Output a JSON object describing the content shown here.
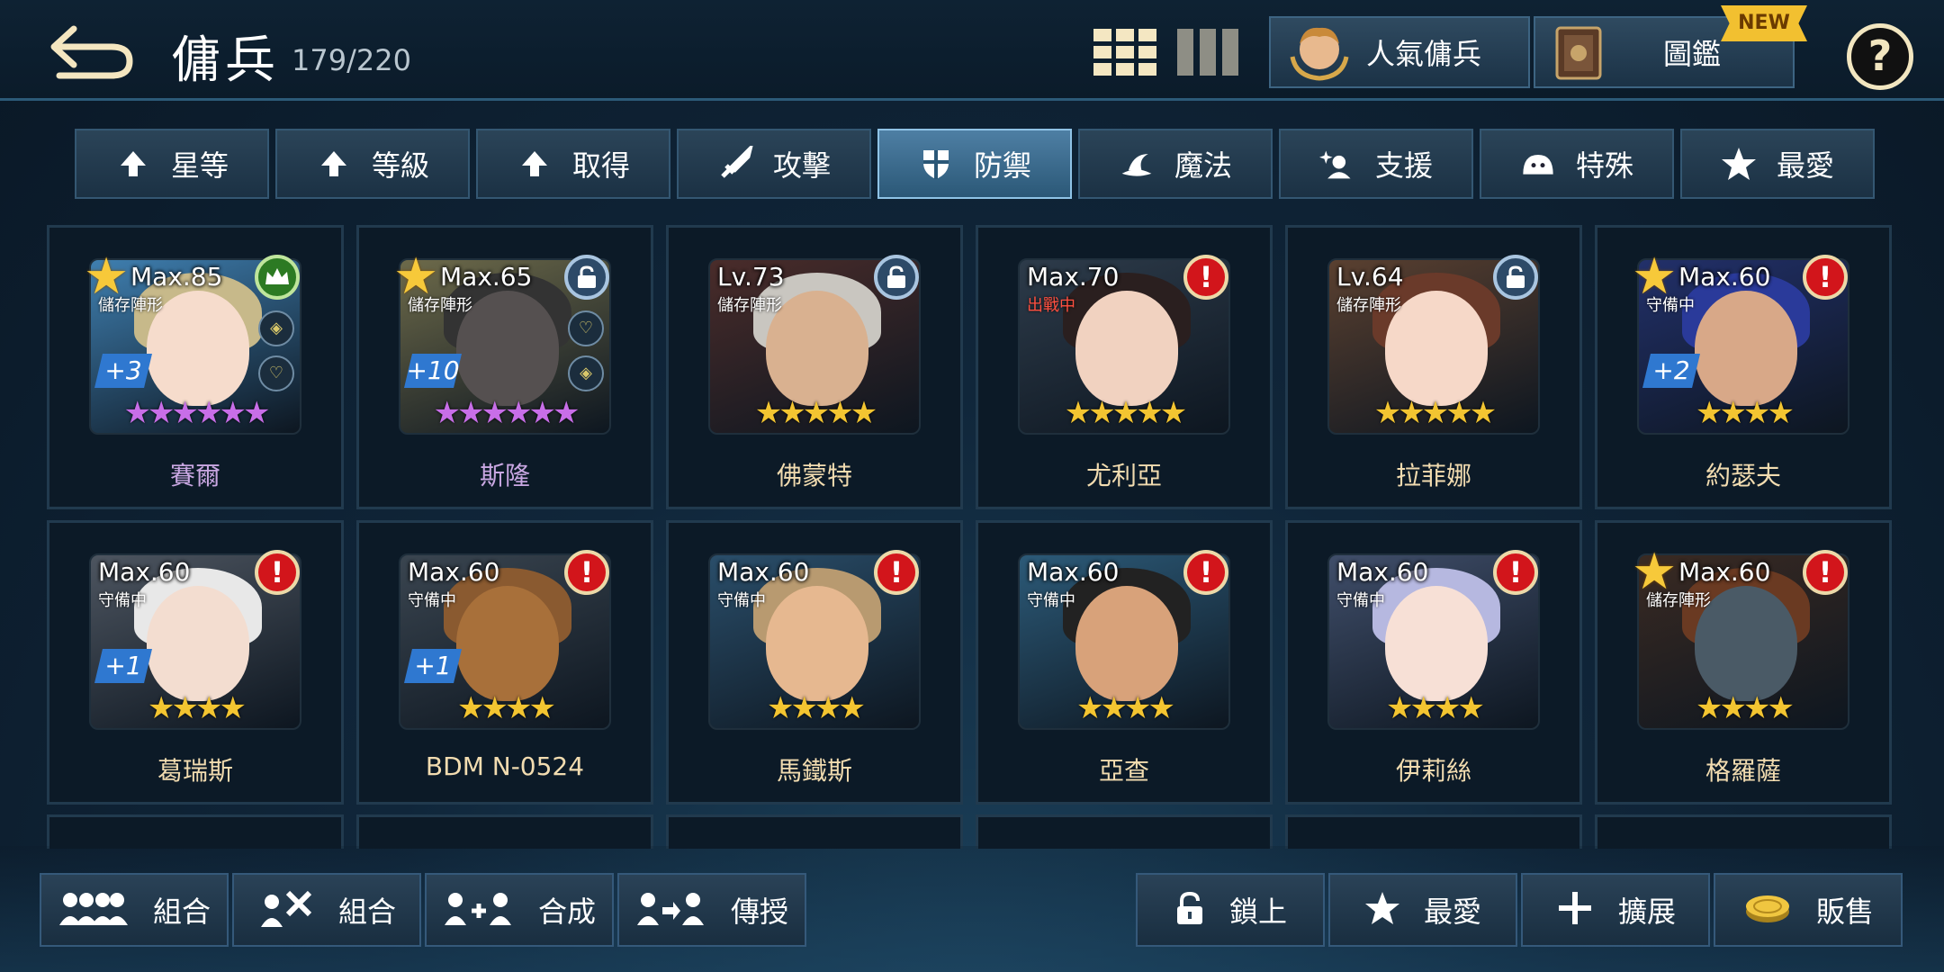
{
  "header": {
    "title": "傭兵",
    "count": "179/220",
    "popular_label": "人氣傭兵",
    "codex_label": "圖鑑",
    "new_badge": "NEW",
    "help_label": "?"
  },
  "filters": [
    {
      "label": "星等",
      "icon": "arrow-up-icon",
      "active": false
    },
    {
      "label": "等級",
      "icon": "arrow-up-icon",
      "active": false
    },
    {
      "label": "取得",
      "icon": "arrow-up-icon",
      "active": false
    },
    {
      "label": "攻擊",
      "icon": "sword-icon",
      "active": false
    },
    {
      "label": "防禦",
      "icon": "shield-icon",
      "active": true
    },
    {
      "label": "魔法",
      "icon": "wizard-hat-icon",
      "active": false
    },
    {
      "label": "支援",
      "icon": "support-sparkle-icon",
      "active": false
    },
    {
      "label": "特殊",
      "icon": "slime-icon",
      "active": false
    },
    {
      "label": "最愛",
      "icon": "star-icon",
      "active": false
    }
  ],
  "mercenaries": [
    {
      "name": "賽爾",
      "level": "Max.85",
      "status": "儲存陣形",
      "plus": "+3",
      "stars": 6,
      "star_color": "#c86ee8",
      "badge": "crown",
      "favorite": true,
      "name_color": "purple",
      "bg": "#3f7fb0",
      "hair": "#c7b98a",
      "skin": "#f6dccc"
    },
    {
      "name": "斯隆",
      "level": "Max.65",
      "status": "儲存陣形",
      "plus": "+10",
      "stars": 6,
      "star_color": "#c86ee8",
      "badge": "lock",
      "favorite": true,
      "name_color": "purple",
      "bg": "#6d6a4a",
      "hair": "#333333",
      "skin": "#555050"
    },
    {
      "name": "佛蒙特",
      "level": "Lv.73",
      "status": "儲存陣形",
      "plus": "",
      "stars": 5,
      "star_color": "#f3c531",
      "badge": "lock",
      "favorite": false,
      "name_color": "gold",
      "bg": "#4a2c2a",
      "hair": "#c9c6c0",
      "skin": "#d9b190"
    },
    {
      "name": "尤利亞",
      "level": "Max.70",
      "status": "出戰中",
      "plus": "",
      "stars": 5,
      "star_color": "#f3c531",
      "badge": "warn",
      "favorite": false,
      "name_color": "gold",
      "bg": "#2d3b4a",
      "hair": "#2a1f1f",
      "skin": "#f1d2c0"
    },
    {
      "name": "拉菲娜",
      "level": "Lv.64",
      "status": "儲存陣形",
      "plus": "",
      "stars": 5,
      "star_color": "#f3c531",
      "badge": "lock",
      "favorite": false,
      "name_color": "gold",
      "bg": "#5a4030",
      "hair": "#6a3a2a",
      "skin": "#f6d8c8"
    },
    {
      "name": "約瑟夫",
      "level": "Max.60",
      "status": "守備中",
      "plus": "+2",
      "stars": 4,
      "star_color": "#f3c531",
      "badge": "warn",
      "favorite": true,
      "name_color": "gold",
      "bg": "#22306a",
      "hair": "#2a3a9a",
      "skin": "#d8a888"
    },
    {
      "name": "葛瑞斯",
      "level": "Max.60",
      "status": "守備中",
      "plus": "+1",
      "stars": 4,
      "star_color": "#f3c531",
      "badge": "warn",
      "favorite": false,
      "name_color": "gold",
      "bg": "#4d5560",
      "hair": "#e8e8e8",
      "skin": "#f3ddd0"
    },
    {
      "name": "BDM N-0524",
      "level": "Max.60",
      "status": "守備中",
      "plus": "+1",
      "stars": 4,
      "star_color": "#f3c531",
      "badge": "warn",
      "favorite": false,
      "name_color": "gold",
      "bg": "#3a4550",
      "hair": "#8a5a30",
      "skin": "#a8703a"
    },
    {
      "name": "馬鐵斯",
      "level": "Max.60",
      "status": "守備中",
      "plus": "",
      "stars": 4,
      "star_color": "#f3c531",
      "badge": "warn",
      "favorite": false,
      "name_color": "gold",
      "bg": "#2a4e6a",
      "hair": "#b89a70",
      "skin": "#e6b890"
    },
    {
      "name": "亞查",
      "level": "Max.60",
      "status": "守備中",
      "plus": "",
      "stars": 4,
      "star_color": "#f3c531",
      "badge": "warn",
      "favorite": false,
      "name_color": "gold",
      "bg": "#2c5a78",
      "hair": "#222222",
      "skin": "#d8a27a"
    },
    {
      "name": "伊莉絲",
      "level": "Max.60",
      "status": "守備中",
      "plus": "",
      "stars": 4,
      "star_color": "#f3c531",
      "badge": "warn",
      "favorite": false,
      "name_color": "gold",
      "bg": "#404e6a",
      "hair": "#b6b8e0",
      "skin": "#f7e0d6"
    },
    {
      "name": "格羅薩",
      "level": "Max.60",
      "status": "儲存陣形",
      "plus": "",
      "stars": 4,
      "star_color": "#f3c531",
      "badge": "warn",
      "favorite": true,
      "name_color": "gold",
      "bg": "#3a2a22",
      "hair": "#6a3a22",
      "skin": "#4a5a66"
    }
  ],
  "bottom": {
    "left": [
      {
        "label": "組合",
        "icon": "team-icon"
      },
      {
        "label": "組合",
        "icon": "team-sword-icon"
      },
      {
        "label": "合成",
        "icon": "merge-icon"
      },
      {
        "label": "傳授",
        "icon": "transfer-icon"
      }
    ],
    "right": [
      {
        "label": "鎖上",
        "icon": "lock-icon"
      },
      {
        "label": "最愛",
        "icon": "star-icon"
      },
      {
        "label": "擴展",
        "icon": "plus-icon"
      },
      {
        "label": "販售",
        "icon": "coin-icon"
      }
    ]
  }
}
